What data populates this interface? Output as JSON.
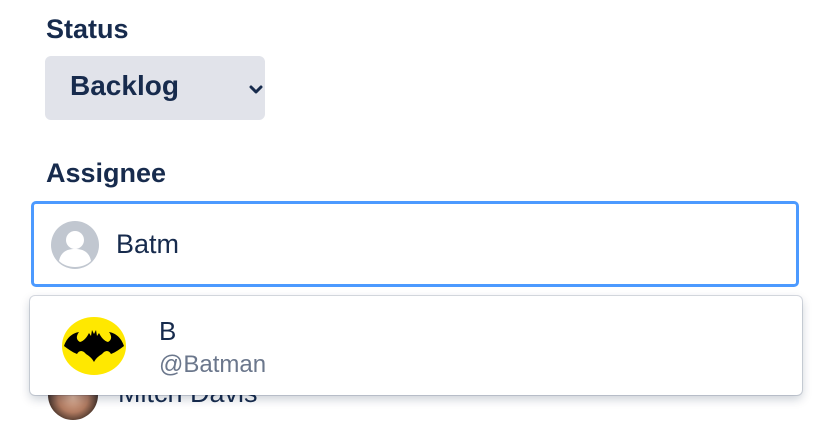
{
  "status": {
    "label": "Status",
    "selected": "Backlog",
    "chevron_icon": "chevron-down-icon"
  },
  "assignee": {
    "label": "Assignee",
    "input_value": "Batm",
    "avatar_icon": "default-avatar-icon"
  },
  "suggestions": [
    {
      "display_name": "B",
      "username": "@Batman",
      "avatar_icon": "bat-symbol-icon"
    }
  ],
  "hidden_option": {
    "name": "Mitch Davis"
  },
  "colors": {
    "text_primary": "#172b4d",
    "text_secondary": "#6b778c",
    "focus_border": "#4c9aff",
    "dropdown_bg": "#e1e3ea",
    "bat_yellow": "#ffe800"
  }
}
